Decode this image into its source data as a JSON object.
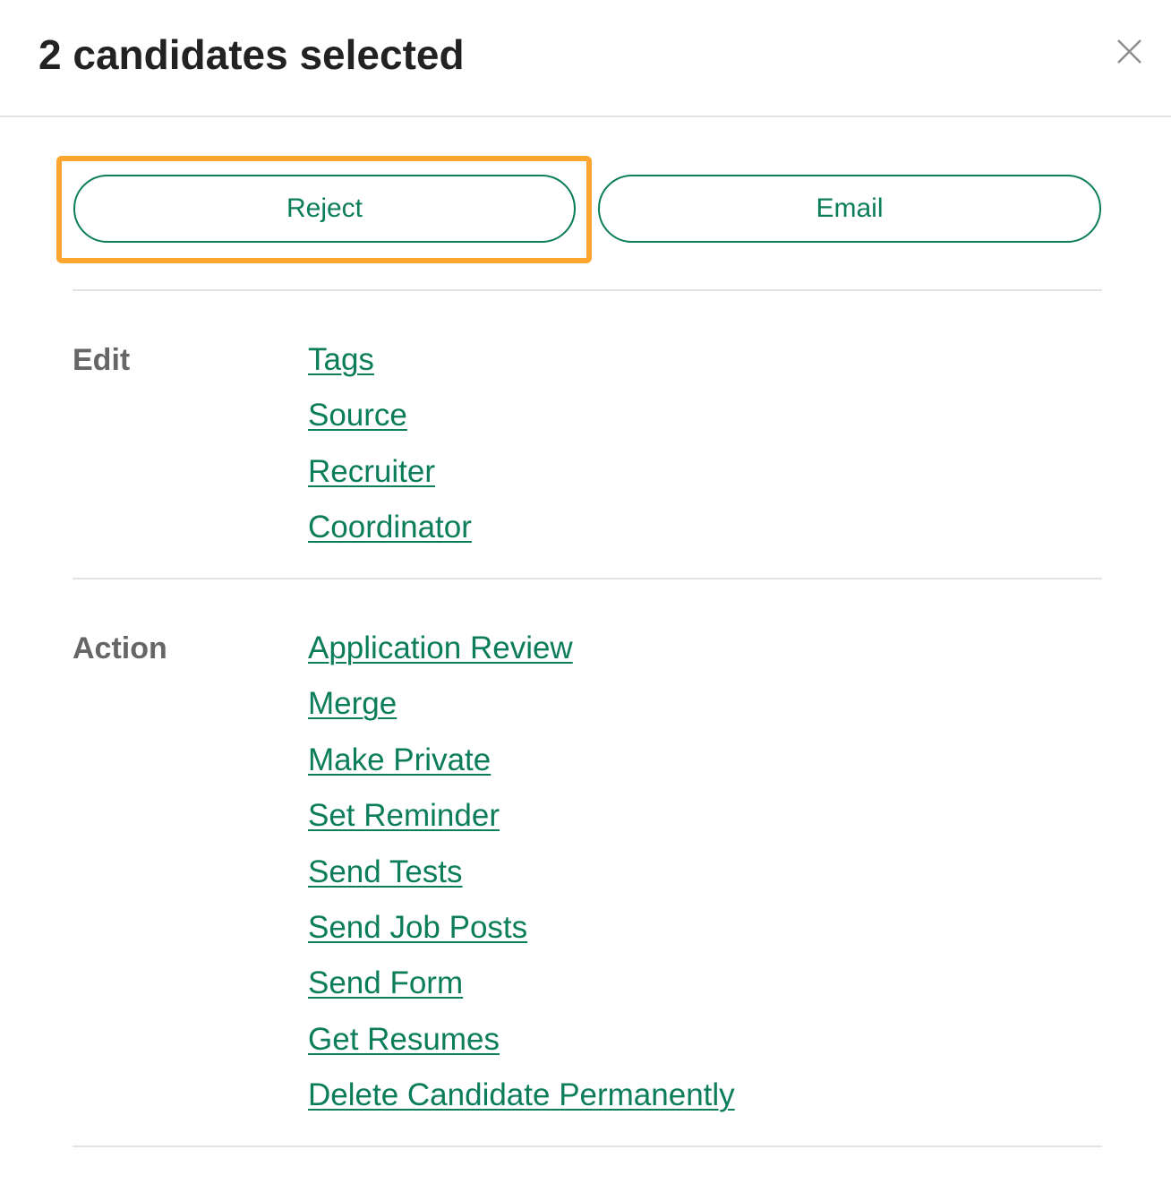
{
  "header": {
    "title": "2 candidates selected",
    "close_icon": "close-icon"
  },
  "buttons": {
    "reject_label": "Reject",
    "email_label": "Email",
    "highlighted": "reject"
  },
  "sections": {
    "edit": {
      "label": "Edit",
      "links": [
        "Tags",
        "Source",
        "Recruiter",
        "Coordinator"
      ]
    },
    "action": {
      "label": "Action",
      "links": [
        "Application Review",
        "Merge",
        "Make Private",
        "Set Reminder",
        "Send Tests",
        "Send Job Posts",
        "Send Form",
        "Get Resumes",
        "Delete Candidate Permanently"
      ]
    }
  },
  "colors": {
    "brand_green": "#0b7d5a",
    "highlight_orange": "#fda52e",
    "label_gray": "#666666",
    "title_text": "#222222"
  }
}
